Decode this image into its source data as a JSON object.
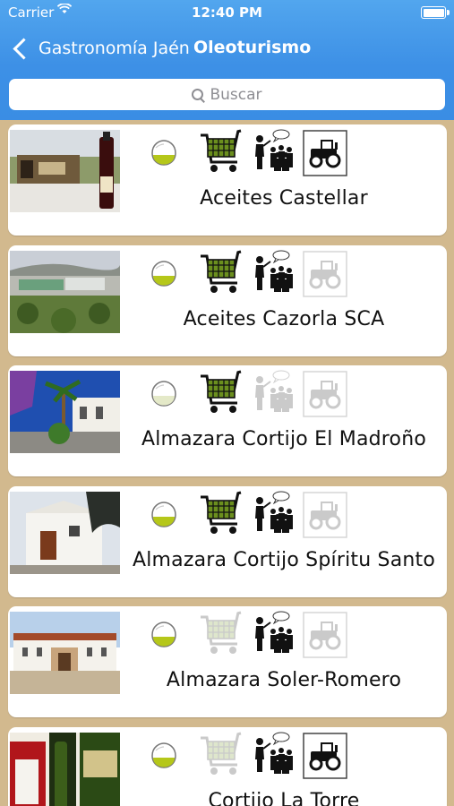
{
  "status_bar": {
    "carrier": "Carrier",
    "time": "12:40 PM"
  },
  "nav": {
    "back_label": "Gastronomía Jaén",
    "title": "Oleoturismo"
  },
  "search": {
    "placeholder": "Buscar"
  },
  "colors": {
    "header": "#3d90e6",
    "background": "#d2b98e",
    "oil": "#b5c71a"
  },
  "icons": [
    "olive-oil-drop-icon",
    "shopping-cart-icon",
    "guided-tour-icon",
    "tractor-icon"
  ],
  "items": [
    {
      "name": "Aceites Castellar",
      "oil": true,
      "shop": true,
      "tour": true,
      "tractor": true,
      "photo": "storefront-photo"
    },
    {
      "name": "Aceites Cazorla SCA",
      "oil": true,
      "shop": true,
      "tour": true,
      "tractor": false,
      "photo": "industrial-plant-photo"
    },
    {
      "name": "Almazara Cortijo El Madroño",
      "oil": false,
      "shop": true,
      "tour": false,
      "tractor": false,
      "photo": "palm-courtyard-photo"
    },
    {
      "name": "Almazara Cortijo Spíritu Santo",
      "oil": true,
      "shop": true,
      "tour": true,
      "tractor": false,
      "photo": "white-farmhouse-photo"
    },
    {
      "name": "Almazara Soler-Romero",
      "oil": true,
      "shop": false,
      "tour": true,
      "tractor": false,
      "photo": "estate-building-photo"
    },
    {
      "name": "Cortijo La Torre",
      "oil": true,
      "shop": false,
      "tour": true,
      "tractor": true,
      "photo": "bottle-label-photo"
    }
  ]
}
